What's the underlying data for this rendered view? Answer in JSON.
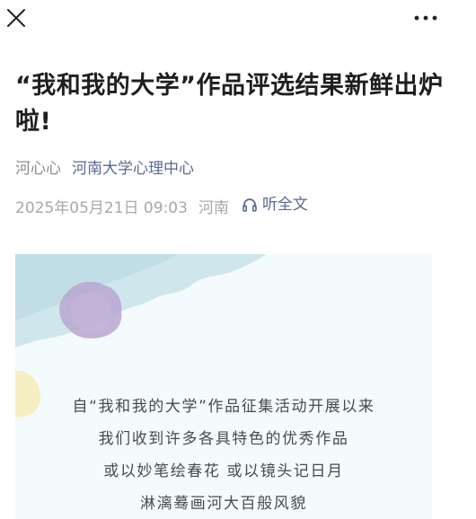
{
  "header": {
    "close_icon": "close-icon",
    "more_icon": "more-dots-icon"
  },
  "article": {
    "title": "“我和我的大学”作品评选结果新鲜出炉啦!",
    "author": "河心心",
    "account_name": "河南大学心理中心",
    "publish_time": "2025年05月21日 09:03",
    "region": "河南",
    "listen_label": "听全文",
    "listen_icon": "headphones-icon"
  },
  "poster": {
    "lines": [
      "自“我和我的大学”作品征集活动开展以来",
      "我们收到许多各具特色的优秀作品",
      "或以妙笔绘春花 或以镜头记日月",
      "淋漓蓦画河大百般风貌"
    ],
    "colors": {
      "background": "#f4fbfc",
      "wash": "#c9e2ea",
      "purple_blot": "#b9a6cf",
      "yellow_blot": "#f7efc4"
    }
  },
  "colors": {
    "link": "#576b95",
    "muted": "#a7a7a7",
    "title": "#1f1f1f"
  }
}
